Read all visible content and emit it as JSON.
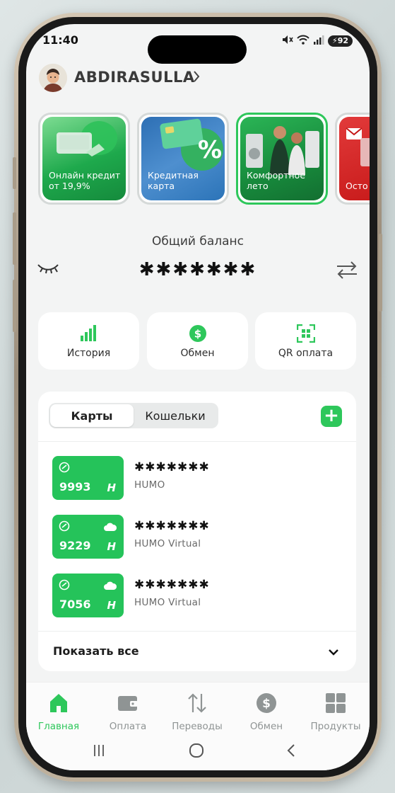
{
  "status_bar": {
    "time": "11:40",
    "battery": "92"
  },
  "header": {
    "user_name": "ABDIRASULLA"
  },
  "stories": [
    {
      "label": "Онлайн кредит от 19,9%",
      "bg": "#1ea94c"
    },
    {
      "label": "Кредитная карта",
      "bg": "#3a7dc4"
    },
    {
      "label": "Комфортное лето",
      "bg": "#1b8f40"
    },
    {
      "label": "Осто Мош",
      "bg": "#cf1f1f"
    }
  ],
  "balance": {
    "title": "Общий баланс",
    "value": "✱✱✱✱✱✱✱"
  },
  "quick_actions": [
    {
      "label": "История"
    },
    {
      "label": "Обмен"
    },
    {
      "label": "QR оплата"
    }
  ],
  "cards_panel": {
    "tabs": [
      "Карты",
      "Кошельки"
    ],
    "add_label": "+",
    "cards": [
      {
        "number": "9993",
        "mask": "✱✱✱✱✱✱✱",
        "type": "HUMO"
      },
      {
        "number": "9229",
        "mask": "✱✱✱✱✱✱✱",
        "type": "HUMO Virtual"
      },
      {
        "number": "7056",
        "mask": "✱✱✱✱✱✱✱",
        "type": "HUMO Virtual"
      }
    ],
    "show_all": "Показать все"
  },
  "bottom_nav": [
    {
      "label": "Главная",
      "icon": "home-icon",
      "active": true
    },
    {
      "label": "Оплата",
      "icon": "wallet-icon"
    },
    {
      "label": "Переводы",
      "icon": "transfer-icon"
    },
    {
      "label": "Обмен",
      "icon": "dollar-icon"
    },
    {
      "label": "Продукты",
      "icon": "grid-icon"
    }
  ],
  "colors": {
    "accent": "#2ec75b",
    "background": "#f3f4f4"
  }
}
